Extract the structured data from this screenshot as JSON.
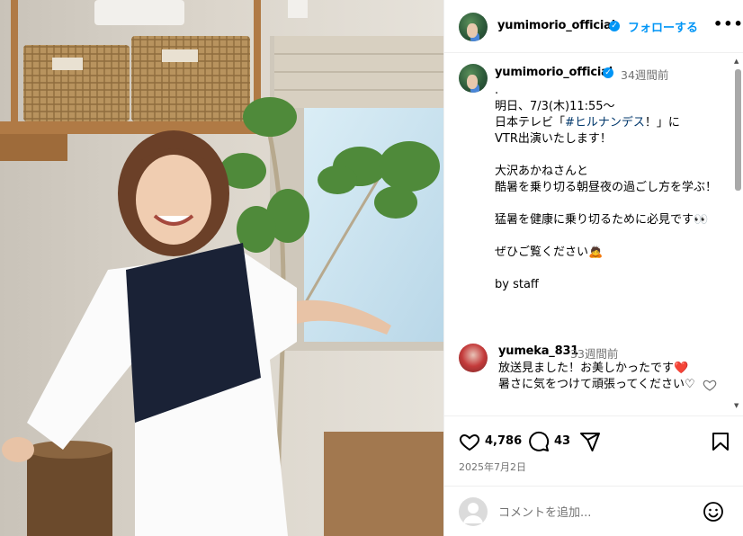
{
  "header": {
    "username": "yumimorio_official",
    "follow_label": "フォローする",
    "more_label": "•••"
  },
  "caption": {
    "username": "yumimorio_official",
    "time": "34週間前",
    "line_pre": ".\n明日、7/3(木)11:55〜\n日本テレビ「",
    "hashtag": "#ヒルナンデス",
    "line_post": "！」に\nVTR出演いたします！\n\n大沢あかねさんと\n酷暑を乗り切る朝昼夜の過ごし方を学ぶ！\n\n猛暑を健康に乗り切るために必見です👀\n\nぜひご覧ください🙇\n\nby staff"
  },
  "comment": {
    "username": "yumeka_831",
    "time": "33週間前",
    "text": "放送見ました！お美しかったです❤️暑さに気をつけて頑張ってください♡"
  },
  "actions": {
    "likes": "4,786",
    "comments": "43",
    "date": "2025年7月2日"
  },
  "add_comment": {
    "placeholder": "コメントを追加..."
  },
  "icons": {
    "verified": "verified-badge",
    "like": "heart-icon",
    "comment": "comment-icon",
    "share": "share-icon",
    "save": "bookmark-icon",
    "emoji": "emoji-icon"
  },
  "colors": {
    "accent": "#0095f6",
    "hashtag": "#00376b",
    "secondary_text": "#737373",
    "heart": "#e02020"
  }
}
